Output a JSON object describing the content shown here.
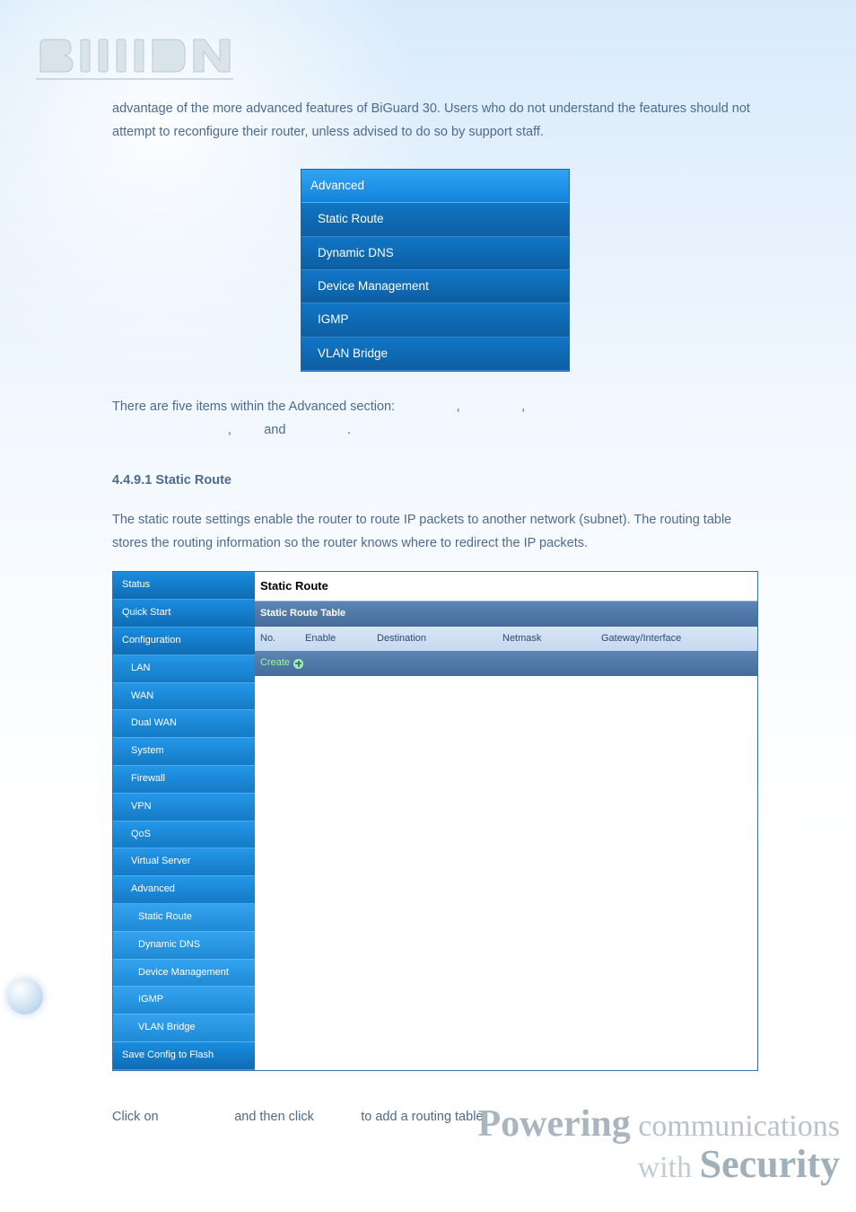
{
  "intro_paragraph": "advantage of the more advanced features of BiGuard 30. Users who do not understand the features should not attempt to reconfigure their router, unless advised to do so by support staff.",
  "advanced_menu": {
    "header": "Advanced",
    "items": [
      "Static Route",
      "Dynamic DNS",
      "Device Management",
      "IGMP",
      "VLAN Bridge"
    ]
  },
  "items_sentence_prefix": "There are five items within the Advanced section:",
  "items_connector": "and",
  "section_heading": "4.4.9.1 Static Route",
  "static_route_paragraph": "The static route settings enable the router to route IP packets to another network (subnet). The routing table stores the routing information so the router knows where to redirect the IP packets.",
  "app": {
    "side": [
      "Status",
      "Quick Start",
      "Configuration",
      "LAN",
      "WAN",
      "Dual WAN",
      "System",
      "Firewall",
      "VPN",
      "QoS",
      "Virtual Server",
      "Advanced",
      "Static Route",
      "Dynamic DNS",
      "Device Management",
      "IGMP",
      "VLAN Bridge",
      "Save Config to Flash"
    ],
    "title": "Static Route",
    "subtitle": "Static Route Table",
    "cols": {
      "no": "No.",
      "enable": "Enable",
      "dest": "Destination",
      "mask": "Netmask",
      "gw": "Gateway/Interface"
    },
    "create": "Create"
  },
  "closing_sentence": {
    "p1": "Click on",
    "p2": "and then click",
    "p3": "to add a routing table."
  },
  "footer": {
    "word1a": "Powering",
    "word1b": "communications",
    "word2a": "with",
    "word2b": "Security"
  }
}
